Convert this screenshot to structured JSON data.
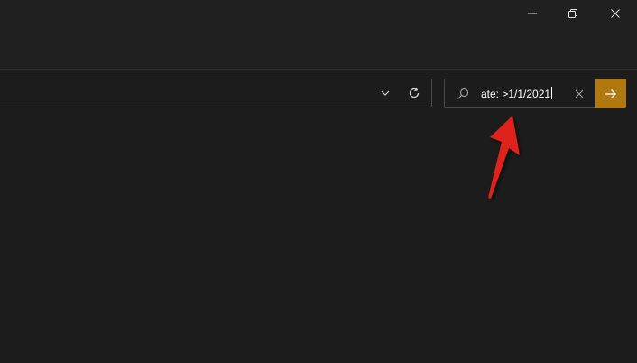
{
  "window_controls": {
    "minimize_icon": "minimize-icon",
    "maximize_icon": "restore-icon",
    "close_icon": "close-icon"
  },
  "address_bar": {
    "dropdown_icon": "chevron-down-icon",
    "refresh_icon": "refresh-icon"
  },
  "search": {
    "icon": "search-icon",
    "value": "ate: >1/1/2021",
    "clear_icon": "clear-icon",
    "go_icon": "arrow-right-icon"
  },
  "colors": {
    "background": "#1c1c1c",
    "titlebar": "#202020",
    "accent": "#b07810",
    "annotation": "#e0201e"
  }
}
